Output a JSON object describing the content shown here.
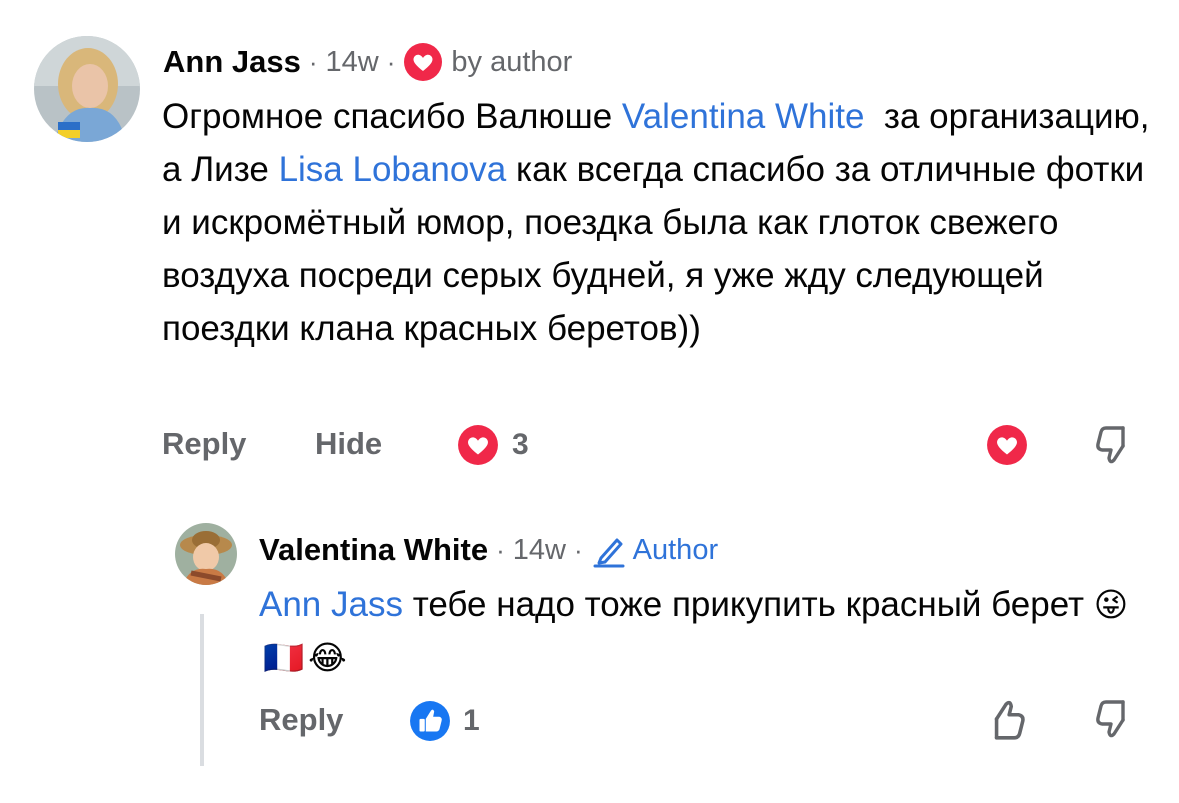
{
  "comments": [
    {
      "author": "Ann Jass",
      "time": "14w",
      "separator": "·",
      "badge_label": "by author",
      "text_parts": [
        {
          "t": "Огромное спасибо Валюше "
        },
        {
          "t": "Valentina White",
          "mention": true
        },
        {
          "t": "  за организацию, а Лизе "
        },
        {
          "t": "Lisa Lobanova",
          "mention": true
        },
        {
          "t": " как всегда спасибо за отличные фотки и искромётный юмор, поездка была как глоток свежего воздуха посреди серых будней, я уже жду следующей поездки клана красных беретов))"
        }
      ],
      "actions": {
        "reply": "Reply",
        "hide": "Hide"
      },
      "reaction_count": "3"
    },
    {
      "author": "Valentina White",
      "time": "14w",
      "separator": "·",
      "badge_label": "Author",
      "text_parts": [
        {
          "t": "Ann Jass",
          "mention": true
        },
        {
          "t": " тебе надо тоже прикупить красный берет "
        }
      ],
      "emojis": [
        "😜",
        "🇫🇷",
        "😂"
      ],
      "actions": {
        "reply": "Reply"
      },
      "reaction_count": "1"
    }
  ],
  "colors": {
    "heart": "#f02849",
    "like": "#1877f2",
    "mention": "#2f73d9",
    "muted": "#65676b"
  },
  "icons": [
    "heart-icon",
    "thumbs-up-icon",
    "thumbs-down-icon",
    "pencil-icon"
  ]
}
